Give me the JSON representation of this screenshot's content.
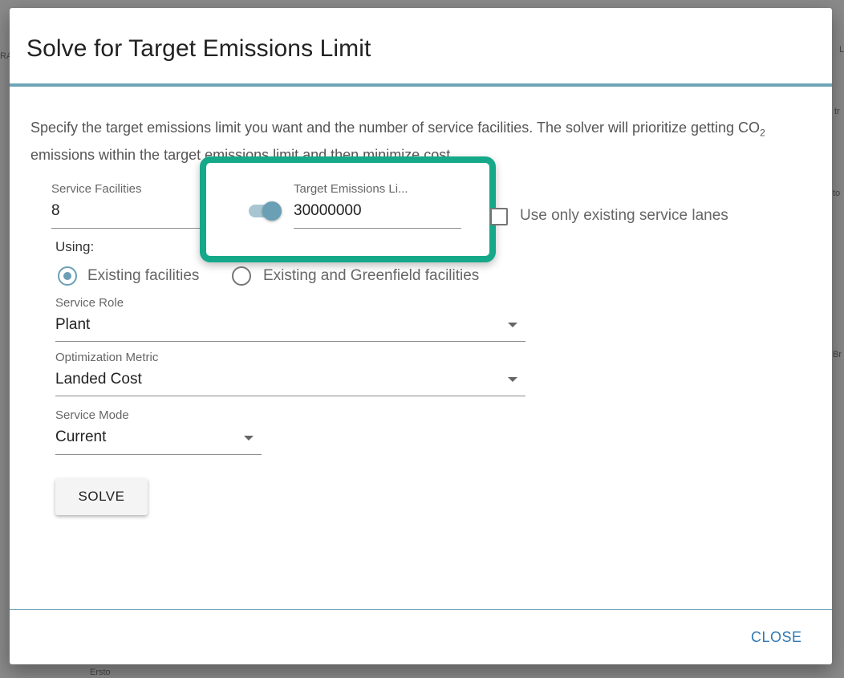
{
  "background": {
    "fragments": [
      "RAS",
      "L",
      "tr",
      "to",
      "Br",
      "Ersto"
    ]
  },
  "dialog": {
    "title": "Solve for Target Emissions Limit",
    "description_part1": "Specify the target emissions limit you want and the number of service facilities. The solver will prioritize getting CO",
    "description_sub": "2",
    "description_part2": " emissions within the target emissions limit and then minimize cost.",
    "service_facilities": {
      "label": "Service Facilities",
      "value": "8"
    },
    "target_emissions": {
      "label": "Target Emissions Li...",
      "value": "30000000",
      "toggle_on": true
    },
    "existing_lanes": {
      "label": "Use only existing service lanes",
      "checked": false
    },
    "using": {
      "label": "Using:",
      "options": [
        "Existing facilities",
        "Existing and Greenfield facilities"
      ],
      "selected": "Existing facilities"
    },
    "service_role": {
      "label": "Service Role",
      "value": "Plant"
    },
    "optimization_metric": {
      "label": "Optimization Metric",
      "value": "Landed Cost"
    },
    "service_mode": {
      "label": "Service Mode",
      "value": "Current"
    },
    "solve_label": "SOLVE",
    "close_label": "CLOSE"
  },
  "colors": {
    "accent": "#6a9fb5",
    "highlight": "#15a889",
    "link": "#2f78b5"
  }
}
